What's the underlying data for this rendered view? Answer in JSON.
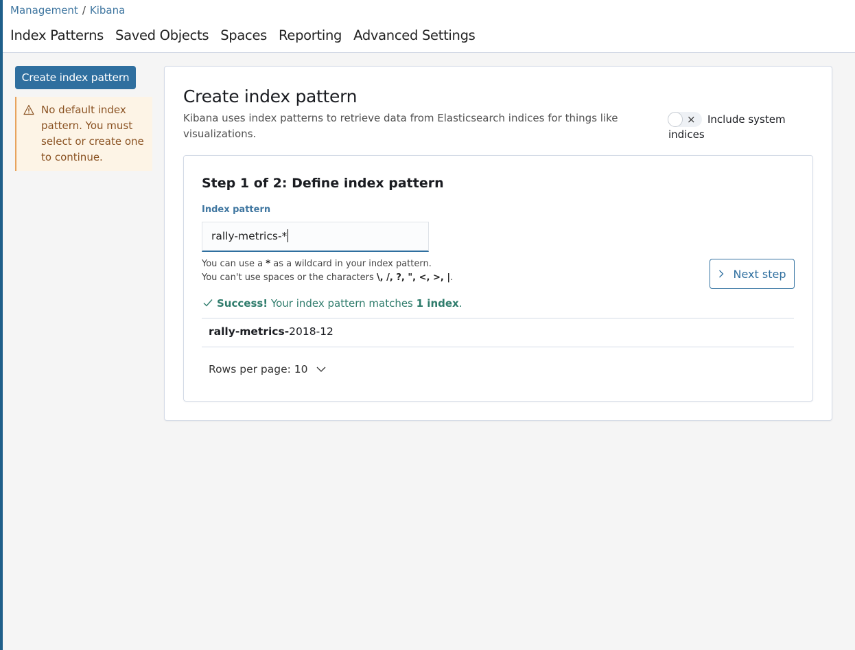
{
  "breadcrumb": {
    "root": "Management",
    "separator": "/",
    "current": "Kibana"
  },
  "nav": {
    "tabs": [
      "Index Patterns",
      "Saved Objects",
      "Spaces",
      "Reporting",
      "Advanced Settings"
    ]
  },
  "sidebar": {
    "create_button": "Create index pattern",
    "callout_text": "No default index pattern. You must select or create one to continue."
  },
  "panel": {
    "title": "Create index pattern",
    "description": "Kibana uses index patterns to retrieve data from Elasticsearch indices for things like visualizations.",
    "toggle_label": "Include system indices",
    "toggle_icon": "×"
  },
  "step": {
    "title": "Step 1 of 2: Define index pattern",
    "field_label": "Index pattern",
    "input_value": "rally-metrics-*",
    "help_line1_pre": "You can use a ",
    "help_line1_bold": "*",
    "help_line1_post": " as a wildcard in your index pattern.",
    "help_line2_pre": "You can't use spaces or the characters ",
    "help_line2_chars": "\\, /, ?, \", <, >, |",
    "help_line2_post": ".",
    "next_button": "Next step",
    "success_bold": "Success!",
    "success_text": " Your index pattern matches ",
    "success_count": "1 index",
    "success_end": ".",
    "match_bold": "rally-metrics-",
    "match_rest": "2018-12",
    "rows_per_page": "Rows per page: 10"
  },
  "colors": {
    "accent": "#2f6f9f",
    "success": "#2f7c6c",
    "warning": "#8a5222"
  },
  "icons": {
    "warning": "warning-icon",
    "next": "chevron-right-icon",
    "check": "check-icon",
    "dropdown": "chevron-down-icon"
  }
}
